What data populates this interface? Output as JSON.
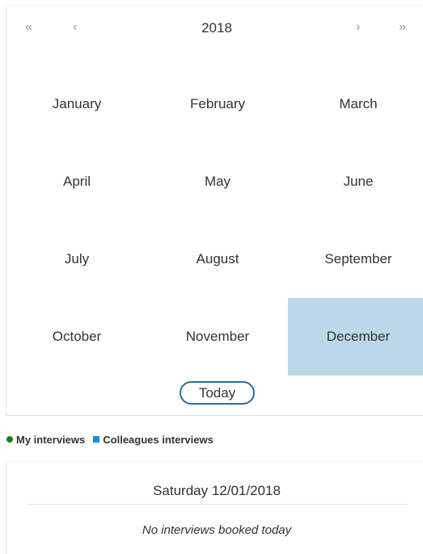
{
  "calendar": {
    "title": "2018",
    "nav": {
      "prev_year": "«",
      "prev": "‹",
      "next": "›",
      "next_year": "»"
    },
    "months": [
      {
        "label": "January",
        "selected": false
      },
      {
        "label": "February",
        "selected": false
      },
      {
        "label": "March",
        "selected": false
      },
      {
        "label": "April",
        "selected": false
      },
      {
        "label": "May",
        "selected": false
      },
      {
        "label": "June",
        "selected": false
      },
      {
        "label": "July",
        "selected": false
      },
      {
        "label": "August",
        "selected": false
      },
      {
        "label": "September",
        "selected": false
      },
      {
        "label": "October",
        "selected": false
      },
      {
        "label": "November",
        "selected": false
      },
      {
        "label": "December",
        "selected": true
      }
    ],
    "today_label": "Today",
    "selected_color": "#bcd7e7",
    "today_border_color": "#2c6e9b"
  },
  "legend": {
    "items": [
      {
        "label": "My interviews",
        "icon": "green-dot-icon",
        "color": "#1a7f1a"
      },
      {
        "label": "Colleagues interviews",
        "icon": "blue-square-icon",
        "color": "#1e8bd6"
      }
    ]
  },
  "day": {
    "title": "Saturday 12/01/2018",
    "empty_message": "No interviews booked today"
  }
}
